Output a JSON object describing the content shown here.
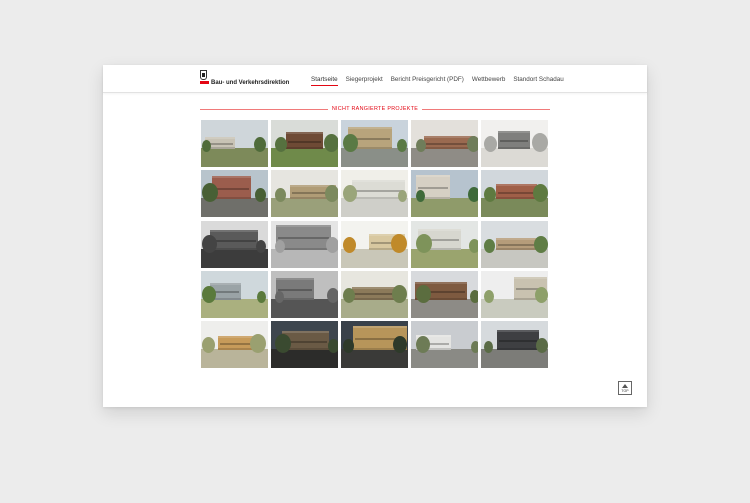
{
  "header": {
    "logo_text": "Bau- und Verkehrsdirektion",
    "nav": [
      {
        "label": "Startseite",
        "active": true
      },
      {
        "label": "Siegerprojekt",
        "active": false
      },
      {
        "label": "Bericht Preisgericht (PDF)",
        "active": false
      },
      {
        "label": "Wettbewerb",
        "active": false
      },
      {
        "label": "Standort Schadau",
        "active": false
      }
    ]
  },
  "section": {
    "title": "NICHT RANGIERTE PROJEKTE"
  },
  "gallery": {
    "tiles": [
      {
        "sky": "#cfd6da",
        "ground": "#7d8a5a",
        "bld": "#c8c3b5",
        "tree": "#4f6b3a"
      },
      {
        "sky": "#d9dcd8",
        "ground": "#6f8a4a",
        "bld": "#6e4a35",
        "tree": "#56713f"
      },
      {
        "sky": "#c9d3dc",
        "ground": "#8a8f88",
        "bld": "#b8a47c",
        "tree": "#5a7a45"
      },
      {
        "sky": "#e3e0db",
        "ground": "#8f8c86",
        "bld": "#9a6a50",
        "tree": "#6f7d5a"
      },
      {
        "sky": "#f1f0ee",
        "ground": "#dcdad5",
        "bld": "#7f7f7d",
        "tree": "#a9a9a5"
      },
      {
        "sky": "#b8c4cc",
        "ground": "#6f6f6a",
        "bld": "#9b5d4d",
        "tree": "#486035"
      },
      {
        "sky": "#e6e5e0",
        "ground": "#9aa07a",
        "bld": "#b09c76",
        "tree": "#7c8a5e"
      },
      {
        "sky": "#f0efe9",
        "ground": "#cfcfc9",
        "bld": "#dcdcd5",
        "tree": "#9aa57a"
      },
      {
        "sky": "#b6c3ce",
        "ground": "#8f9b6a",
        "bld": "#d6d0c4",
        "tree": "#3f6a3a"
      },
      {
        "sky": "#d1d7dc",
        "ground": "#7a8a5a",
        "bld": "#a05f48",
        "tree": "#5e7a40"
      },
      {
        "sky": "#dadada",
        "ground": "#3c3c3c",
        "bld": "#5a5a5a",
        "tree": "#444444"
      },
      {
        "sky": "#e5e5e5",
        "ground": "#b7b7b7",
        "bld": "#8a8a8a",
        "tree": "#a0a0a0"
      },
      {
        "sky": "#f3f3ef",
        "ground": "#c9c7b8",
        "bld": "#d8c8a0",
        "tree": "#c08a2a"
      },
      {
        "sky": "#e3e6e4",
        "ground": "#9aa46e",
        "bld": "#d7d7cf",
        "tree": "#7e935a"
      },
      {
        "sky": "#d9dde0",
        "ground": "#c7c7c1",
        "bld": "#b59c7a",
        "tree": "#5f7d45"
      },
      {
        "sky": "#cfd8dc",
        "ground": "#aab07f",
        "bld": "#9aa3a6",
        "tree": "#5a7a3c"
      },
      {
        "sky": "#bfbfbf",
        "ground": "#555555",
        "bld": "#7a7a7a",
        "tree": "#666666"
      },
      {
        "sky": "#e7e6df",
        "ground": "#a8ac8a",
        "bld": "#8c7a5a",
        "tree": "#6e7e4e"
      },
      {
        "sky": "#d8dadd",
        "ground": "#8d8b86",
        "bld": "#7e5a40",
        "tree": "#5b6d3f"
      },
      {
        "sky": "#eeeeee",
        "ground": "#c9cbbf",
        "bld": "#c9c2b0",
        "tree": "#8ea06a"
      },
      {
        "sky": "#eeeeec",
        "ground": "#b9b49a",
        "bld": "#c79b5a",
        "tree": "#9aa070"
      },
      {
        "sky": "#3e464e",
        "ground": "#2c2c2a",
        "bld": "#6a5a45",
        "tree": "#3a4a30"
      },
      {
        "sky": "#39414a",
        "ground": "#3a3a38",
        "bld": "#b7955a",
        "tree": "#2e3a2a"
      },
      {
        "sky": "#c9ccd0",
        "ground": "#8a8a85",
        "bld": "#e4e4e2",
        "tree": "#6d7b56"
      },
      {
        "sky": "#d6dadd",
        "ground": "#7c7c78",
        "bld": "#3e3f42",
        "tree": "#5a6b46"
      }
    ]
  },
  "top_button": {
    "label": "TOP"
  }
}
